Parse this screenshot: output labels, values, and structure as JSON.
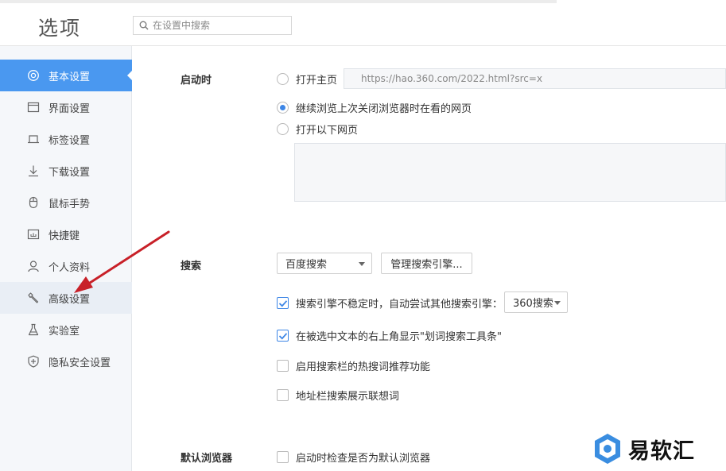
{
  "header": {
    "title": "选项",
    "search_placeholder": "在设置中搜索"
  },
  "sidebar": {
    "items": [
      {
        "label": "基本设置",
        "icon": "settings-icon",
        "active": true
      },
      {
        "label": "界面设置",
        "icon": "window-icon"
      },
      {
        "label": "标签设置",
        "icon": "tab-icon"
      },
      {
        "label": "下载设置",
        "icon": "download-icon"
      },
      {
        "label": "鼠标手势",
        "icon": "mouse-icon"
      },
      {
        "label": "快捷键",
        "icon": "shortcut-icon"
      },
      {
        "label": "个人资料",
        "icon": "user-icon"
      },
      {
        "label": "高级设置",
        "icon": "wrench-icon"
      },
      {
        "label": "实验室",
        "icon": "flask-icon"
      },
      {
        "label": "隐私安全设置",
        "icon": "shield-icon"
      }
    ]
  },
  "startup": {
    "label": "启动时",
    "option_home": "打开主页",
    "home_url": "https://hao.360.com/2022.html?src=x",
    "option_continue": "继续浏览上次关闭浏览器时在看的网页",
    "option_pages": "打开以下网页",
    "selected": "continue"
  },
  "search": {
    "label": "搜索",
    "engine": "百度搜索",
    "manage_button": "管理搜索引擎...",
    "fallback_label": "搜索引擎不稳定时，自动尝试其他搜索引擎：",
    "fallback_checked": true,
    "fallback_engine": "360搜索",
    "toolbar_label": "在被选中文本的右上角显示\"划词搜索工具条\"",
    "toolbar_checked": true,
    "hotwords_label": "启用搜索栏的热搜词推荐功能",
    "hotwords_checked": false,
    "suggest_label": "地址栏搜索展示联想词",
    "suggest_checked": false
  },
  "default_browser": {
    "label": "默认浏览器",
    "check_label": "启动时检查是否为默认浏览器",
    "check_checked": false
  },
  "watermark": {
    "text": "易软汇"
  },
  "colors": {
    "accent": "#4a98f0",
    "arrow": "#d0232a"
  }
}
